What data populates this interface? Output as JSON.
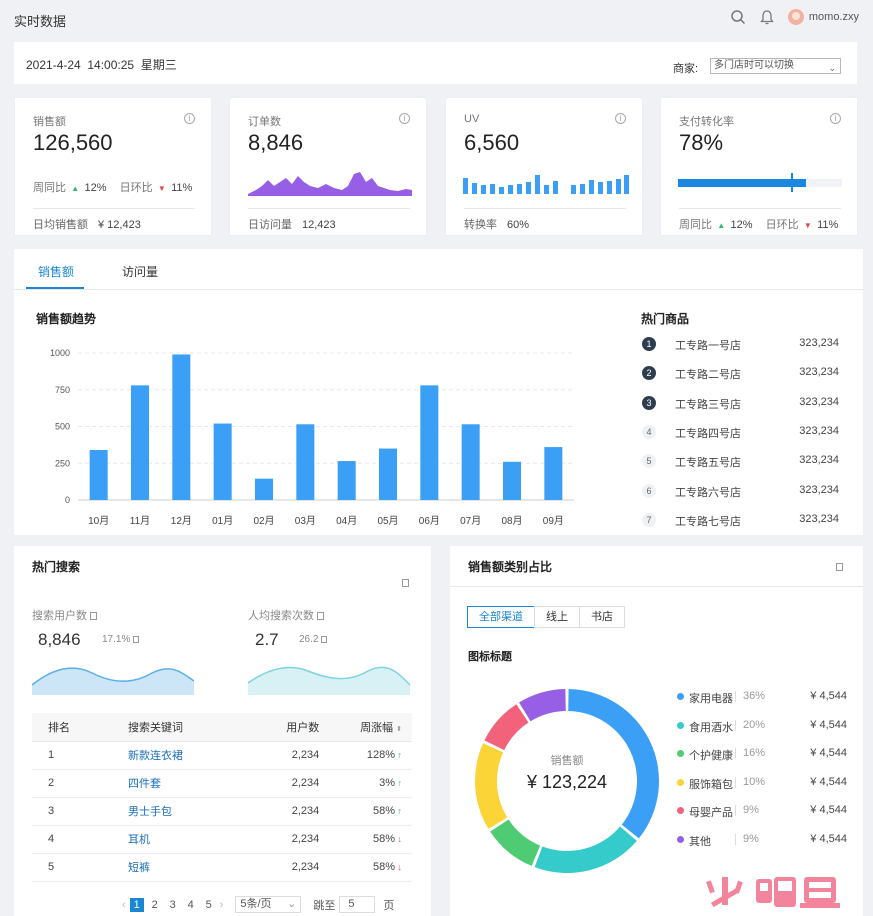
{
  "header": {
    "title": "实时数据",
    "username": "momo.zxy"
  },
  "datebar": {
    "datetime": "2021-4-24  14:00:25  星期三",
    "merchant_label": "商家:",
    "merchant_value": "多门店时可以切换"
  },
  "kpis": {
    "sales": {
      "label": "销售额",
      "value": "126,560",
      "wow_label": "周同比",
      "wow": "12%",
      "dod_label": "日环比",
      "dod": "11%",
      "foot_label": "日均销售额",
      "foot_value": "¥ 12,423"
    },
    "orders": {
      "label": "订单数",
      "value": "8,846",
      "foot_label": "日访问量",
      "foot_value": "12,423"
    },
    "uv": {
      "label": "UV",
      "value": "6,560",
      "foot_label": "转换率",
      "foot_value": "60%"
    },
    "payrate": {
      "label": "支付转化率",
      "value": "78%",
      "progress": 0.78,
      "wow_label": "周同比",
      "wow": "12%",
      "dod_label": "日环比",
      "dod": "11%"
    }
  },
  "tabs": [
    {
      "label": "销售额"
    },
    {
      "label": "访问量"
    }
  ],
  "sales_chart": {
    "title": "销售额趋势"
  },
  "chart_data": {
    "type": "bar",
    "categories": [
      "10月",
      "11月",
      "12月",
      "01月",
      "02月",
      "03月",
      "04月",
      "05月",
      "06月",
      "07月",
      "08月",
      "09月"
    ],
    "values": [
      340,
      780,
      990,
      520,
      145,
      515,
      265,
      350,
      780,
      515,
      260,
      360
    ],
    "yticks": [
      "1000",
      "750",
      "500",
      "250",
      "0"
    ],
    "ylim": [
      0,
      1000
    ],
    "grid": true,
    "color": "#3b9ff5"
  },
  "hot_products": {
    "title": "热门商品",
    "items": [
      {
        "rank": "1",
        "name": "工专路一号店",
        "value": "323,234"
      },
      {
        "rank": "2",
        "name": "工专路二号店",
        "value": "323,234"
      },
      {
        "rank": "3",
        "name": "工专路三号店",
        "value": "323,234"
      },
      {
        "rank": "4",
        "name": "工专路四号店",
        "value": "323,234"
      },
      {
        "rank": "5",
        "name": "工专路五号店",
        "value": "323,234"
      },
      {
        "rank": "6",
        "name": "工专路六号店",
        "value": "323,234"
      },
      {
        "rank": "7",
        "name": "工专路七号店",
        "value": "323,234"
      }
    ]
  },
  "hot_search": {
    "title": "热门搜索",
    "users_label": "搜索用户数",
    "users_value": "8,846",
    "users_change": "17.1%",
    "avg_label": "人均搜索次数",
    "avg_value": "2.7",
    "avg_change": "26.2",
    "table": {
      "headers": [
        "排名",
        "搜索关键词",
        "用户数",
        "周涨幅"
      ],
      "rows": [
        {
          "rank": "1",
          "keyword": "新款连衣裙",
          "users": "2,234",
          "change": "128%",
          "dir": "up"
        },
        {
          "rank": "2",
          "keyword": "四件套",
          "users": "2,234",
          "change": "3%",
          "dir": "up"
        },
        {
          "rank": "3",
          "keyword": "男士手包",
          "users": "2,234",
          "change": "58%",
          "dir": "up"
        },
        {
          "rank": "4",
          "keyword": "耳机",
          "users": "2,234",
          "change": "58%",
          "dir": "down"
        },
        {
          "rank": "5",
          "keyword": "短裤",
          "users": "2,234",
          "change": "58%",
          "dir": "down"
        }
      ]
    },
    "pager": {
      "pages": [
        "1",
        "2",
        "3",
        "4",
        "5"
      ],
      "page_size": "5条/页",
      "goto_label": "跳至",
      "goto_value": "5",
      "page_suffix": "页"
    }
  },
  "category_share": {
    "title": "销售额类别占比",
    "channels": [
      "全部渠道",
      "线上",
      "书店"
    ],
    "legend_title": "图标标题",
    "center_label": "销售额",
    "center_value": "¥ 123,224",
    "items": [
      {
        "name": "家用电器",
        "pct": "36%",
        "value": "¥ 4,544",
        "color": "#3b9ff5",
        "share": 36
      },
      {
        "name": "食用酒水",
        "pct": "20%",
        "value": "¥ 4,544",
        "color": "#36cbcb",
        "share": 20
      },
      {
        "name": "个护健康",
        "pct": "16%",
        "value": "¥ 4,544",
        "color": "#4ecb73",
        "share": 10
      },
      {
        "name": "服饰箱包",
        "pct": "10%",
        "value": "¥ 4,544",
        "color": "#fbd437",
        "share": 16
      },
      {
        "name": "母婴产品",
        "pct": "9%",
        "value": "¥ 4,544",
        "color": "#f2637b",
        "share": 9
      },
      {
        "name": "其他",
        "pct": "9%",
        "value": "¥ 4,544",
        "color": "#975fe5",
        "share": 9
      }
    ]
  }
}
